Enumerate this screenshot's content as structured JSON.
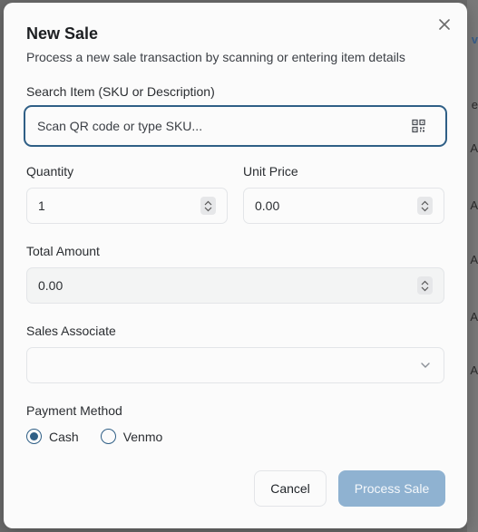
{
  "background_peek": {
    "glyphs": [
      "v",
      "e",
      "A",
      "A",
      "9 A",
      "A",
      "A"
    ]
  },
  "modal": {
    "title": "New Sale",
    "subtitle": "Process a new sale transaction by scanning or entering item details",
    "close_icon": "close-icon"
  },
  "search": {
    "label": "Search Item (SKU or Description)",
    "placeholder": "Scan QR code or type SKU...",
    "icon": "qr-code-icon"
  },
  "quantity": {
    "label": "Quantity",
    "value": "1"
  },
  "unit_price": {
    "label": "Unit Price",
    "value": "0.00"
  },
  "total": {
    "label": "Total Amount",
    "value": "0.00"
  },
  "associate": {
    "label": "Sales Associate",
    "value": ""
  },
  "payment": {
    "label": "Payment Method",
    "options": [
      {
        "label": "Cash",
        "selected": true
      },
      {
        "label": "Venmo",
        "selected": false
      }
    ]
  },
  "actions": {
    "cancel_label": "Cancel",
    "submit_label": "Process Sale"
  },
  "colors": {
    "accent": "#2f5f86",
    "primary_disabled": "#8fb2d1"
  }
}
